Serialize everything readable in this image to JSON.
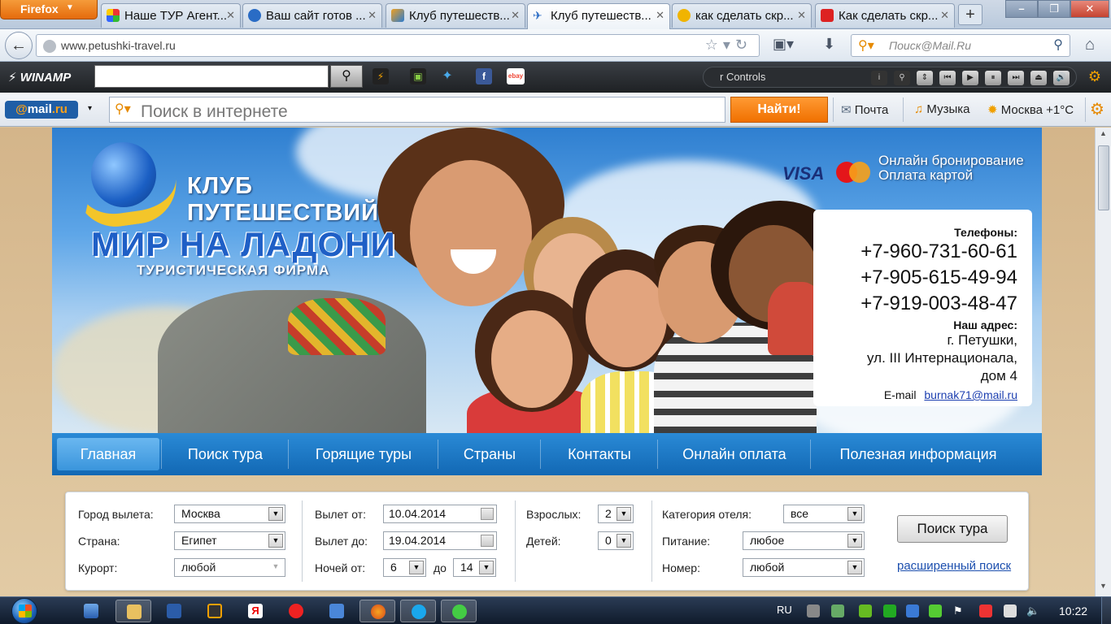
{
  "browser": {
    "menu_label": "Firefox",
    "tabs": [
      {
        "title": "Наше ТУР Агент...",
        "active": false
      },
      {
        "title": "Ваш сайт готов ...",
        "active": false
      },
      {
        "title": "Клуб путешеств...",
        "active": false
      },
      {
        "title": "Клуб путешеств...",
        "active": true
      },
      {
        "title": "как сделать скр...",
        "active": false
      },
      {
        "title": "Как сделать скр...",
        "active": false
      }
    ],
    "url": "www.petushki-travel.ru",
    "search_placeholder": "Поиск@Mail.Ru"
  },
  "winamp": {
    "logo": "WINAMP",
    "controls_label": "r Controls"
  },
  "mailru": {
    "logo_at": "@",
    "logo_text": "mail",
    "logo_tld": ".ru",
    "search_placeholder": "Поиск в интернете",
    "find_button": "Найти!",
    "mail_link": "Почта",
    "music_link": "Музыка",
    "weather": "Москва +1°C"
  },
  "site": {
    "logo": {
      "club": "КЛУБ",
      "club2": "ПУТЕШЕСТВИЙ",
      "main": "МИР НА ЛАДОНИ",
      "sub": "ТУРИСТИЧЕСКАЯ ФИРМА"
    },
    "visa": "VISA",
    "online_booking": "Онлайн бронирование",
    "card_payment": "Оплата картой",
    "contacts": {
      "phones_label": "Телефоны:",
      "phones": [
        "+7-960-731-60-61",
        "+7-905-615-49-94",
        "+7-919-003-48-47"
      ],
      "address_label": "Наш адрес:",
      "address": [
        "г. Петушки,",
        "ул. III Интернационала,",
        "дом 4"
      ],
      "email_label": "E-mail",
      "email": "burnak71@mail.ru"
    },
    "menu": [
      "Главная",
      "Поиск тура",
      "Горящие туры",
      "Страны",
      "Контакты",
      "Онлайн оплата",
      "Полезная информация"
    ],
    "search_form": {
      "city_label": "Город вылета:",
      "city_value": "Москва",
      "country_label": "Страна:",
      "country_value": "Египет",
      "resort_label": "Курорт:",
      "resort_value": "любой",
      "depart_from_label": "Вылет от:",
      "depart_from_value": "10.04.2014",
      "depart_to_label": "Вылет до:",
      "depart_to_value": "19.04.2014",
      "nights_label": "Ночей от:",
      "nights_from": "6",
      "nights_to_label": "до",
      "nights_to": "14",
      "adults_label": "Взрослых:",
      "adults_value": "2",
      "children_label": "Детей:",
      "children_value": "0",
      "hotel_cat_label": "Категория отеля:",
      "hotel_cat_value": "все",
      "meals_label": "Питание:",
      "meals_value": "любое",
      "room_label": "Номер:",
      "room_value": "любой",
      "search_button": "Поиск тура",
      "advanced_link": "расширенный поиск"
    }
  },
  "taskbar": {
    "language": "RU",
    "clock": "10:22"
  }
}
